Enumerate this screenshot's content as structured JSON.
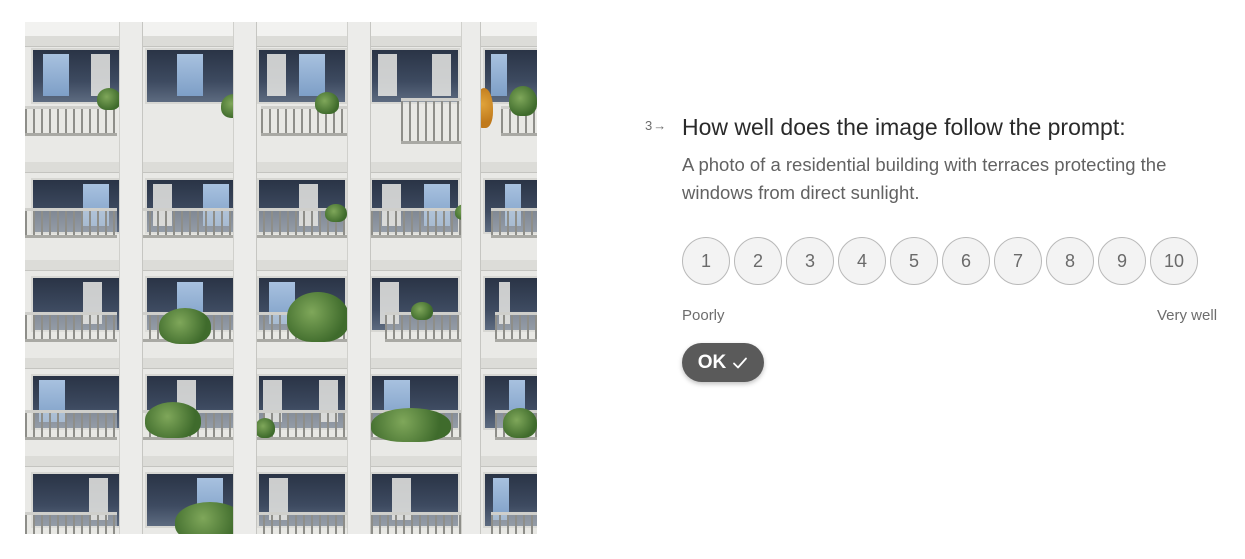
{
  "question": {
    "number": "3",
    "title": "How well does the image follow the prompt:",
    "prompt": "A photo of a residential building with terraces protecting the windows from direct sunlight."
  },
  "scale": {
    "options": [
      "1",
      "2",
      "3",
      "4",
      "5",
      "6",
      "7",
      "8",
      "9",
      "10"
    ],
    "low_label": "Poorly",
    "high_label": "Very well"
  },
  "submit": {
    "label": "OK",
    "icon": "check-icon"
  },
  "image": {
    "subject": "building-photo"
  },
  "colors": {
    "button_bg": "#5a5a5a",
    "option_bg": "#f3f3f3",
    "option_border": "#b9b9b9",
    "title_text": "#2a2a2a",
    "muted_text": "#6d6d6d"
  }
}
